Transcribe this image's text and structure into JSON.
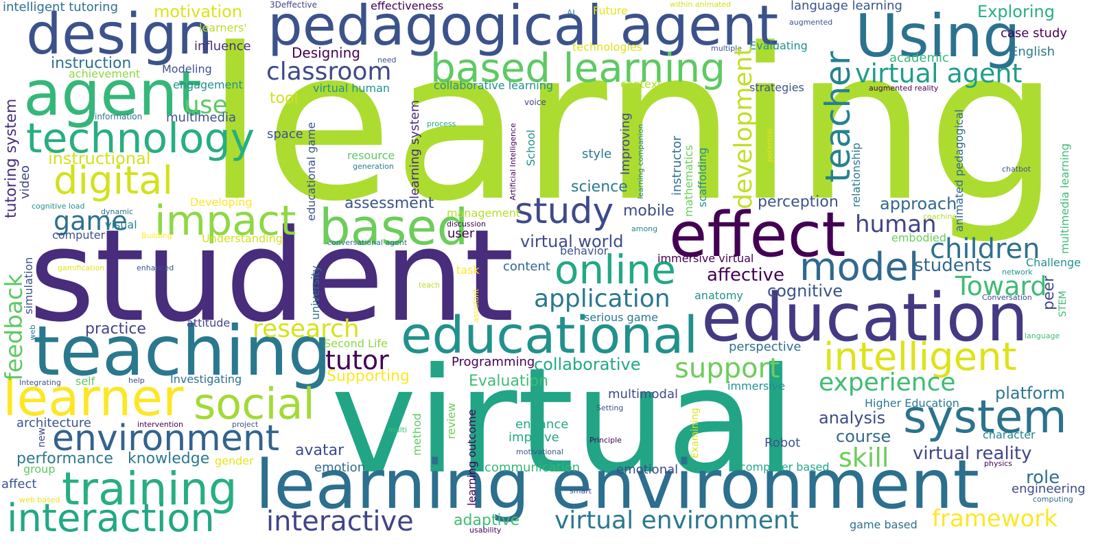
{
  "palette": [
    "#440154",
    "#472d7b",
    "#3b528b",
    "#2c728e",
    "#21918c",
    "#28ae80",
    "#5ec962",
    "#addc30",
    "#fde725"
  ],
  "words": [
    {
      "text": "learning",
      "color": "#addc30"
    },
    {
      "text": "student",
      "color": "#472d7b"
    },
    {
      "text": "virtual",
      "color": "#21a585"
    },
    {
      "text": "learning environment",
      "color": "#2c6f8e"
    },
    {
      "text": "education",
      "color": "#443a83"
    },
    {
      "text": "educational",
      "color": "#21918c"
    },
    {
      "text": "teaching",
      "color": "#2a788e"
    },
    {
      "text": "pedagogical agent",
      "color": "#3b528b"
    },
    {
      "text": "design",
      "color": "#3b528b"
    },
    {
      "text": "agent",
      "color": "#35b779"
    },
    {
      "text": "Using",
      "color": "#2c728e"
    },
    {
      "text": "effect",
      "color": "#440154"
    },
    {
      "text": "technology",
      "color": "#28ae80"
    },
    {
      "text": "based learning",
      "color": "#5ec962"
    },
    {
      "text": "learner",
      "color": "#fde725"
    },
    {
      "text": "training",
      "color": "#28ae80"
    },
    {
      "text": "interaction",
      "color": "#22a884"
    },
    {
      "text": "system",
      "color": "#2c728e"
    },
    {
      "text": "intelligent",
      "color": "#dde318"
    },
    {
      "text": "online",
      "color": "#22a884"
    },
    {
      "text": "based",
      "color": "#6ccd5a"
    },
    {
      "text": "digital",
      "color": "#d2e21b"
    },
    {
      "text": "impact",
      "color": "#8fd744"
    },
    {
      "text": "social",
      "color": "#a2da37"
    },
    {
      "text": "environment",
      "color": "#33638d"
    },
    {
      "text": "model",
      "color": "#31688e"
    },
    {
      "text": "study",
      "color": "#3e4a89"
    },
    {
      "text": "classroom",
      "color": "#3e4a89"
    },
    {
      "text": "virtual agent",
      "color": "#1f9e89"
    },
    {
      "text": "teacher",
      "color": "#26828e"
    },
    {
      "text": "development",
      "color": "#c0df25"
    },
    {
      "text": "application",
      "color": "#2a788e"
    },
    {
      "text": "virtual environment",
      "color": "#2a788e"
    },
    {
      "text": "framework",
      "color": "#fde725"
    },
    {
      "text": "interactive",
      "color": "#414487"
    },
    {
      "text": "research",
      "color": "#d8e219"
    },
    {
      "text": "support",
      "color": "#6ccd5a"
    },
    {
      "text": "experience",
      "color": "#3fbc73"
    },
    {
      "text": "children",
      "color": "#2d708e"
    },
    {
      "text": "game",
      "color": "#2d708e"
    },
    {
      "text": "tutor",
      "color": "#440154"
    },
    {
      "text": "feedback",
      "color": "#5ec962"
    },
    {
      "text": "use",
      "color": "#5ec962"
    },
    {
      "text": "Toward",
      "color": "#3fbc73"
    },
    {
      "text": "virtual world",
      "color": "#3e4a89"
    },
    {
      "text": "human",
      "color": "#414487"
    },
    {
      "text": "students",
      "color": "#31688e"
    },
    {
      "text": "skill",
      "color": "#6ccd5a"
    },
    {
      "text": "collaborative",
      "color": "#22a884"
    },
    {
      "text": "virtual reality",
      "color": "#414487"
    },
    {
      "text": "affective",
      "color": "#440154"
    },
    {
      "text": "cognitive",
      "color": "#3b528b"
    },
    {
      "text": "approach",
      "color": "#31688e"
    },
    {
      "text": "assessment",
      "color": "#3b528b"
    },
    {
      "text": "perception",
      "color": "#3b528b"
    },
    {
      "text": "analysis",
      "color": "#3e4a89"
    },
    {
      "text": "course",
      "color": "#31688e"
    },
    {
      "text": "role",
      "color": "#2d708e"
    },
    {
      "text": "engineering",
      "color": "#3e4a89"
    },
    {
      "text": "platform",
      "color": "#2a788e"
    },
    {
      "text": "Exploring",
      "color": "#28ae80"
    },
    {
      "text": "instructional",
      "color": "#d2e21b"
    },
    {
      "text": "instruction",
      "color": "#2d708e"
    },
    {
      "text": "motivation",
      "color": "#dde318"
    },
    {
      "text": "intelligent tutoring",
      "color": "#2d708e"
    },
    {
      "text": "language learning",
      "color": "#3b528b"
    },
    {
      "text": "case study",
      "color": "#440154"
    },
    {
      "text": "English",
      "color": "#2a788e"
    },
    {
      "text": "academic",
      "color": "#35b779"
    },
    {
      "text": "tutoring system",
      "color": "#472d7b"
    },
    {
      "text": "multimedia",
      "color": "#3b528b"
    },
    {
      "text": "practice",
      "color": "#414487"
    },
    {
      "text": "architecture",
      "color": "#3b528b"
    },
    {
      "text": "performance",
      "color": "#2a788e"
    },
    {
      "text": "knowledge",
      "color": "#2a788e"
    },
    {
      "text": "avatar",
      "color": "#3e4a89"
    },
    {
      "text": "emotion",
      "color": "#31688e"
    },
    {
      "text": "communication",
      "color": "#35b779"
    },
    {
      "text": "emotional",
      "color": "#3e4a89"
    },
    {
      "text": "adaptive",
      "color": "#3fbc73"
    },
    {
      "text": "mobile",
      "color": "#3e4a89"
    },
    {
      "text": "behavior",
      "color": "#3b528b"
    },
    {
      "text": "content",
      "color": "#31688e"
    },
    {
      "text": "immersive virtual",
      "color": "#440154"
    },
    {
      "text": "anatomy",
      "color": "#21918c"
    },
    {
      "text": "serious game",
      "color": "#2a788e"
    },
    {
      "text": "perspective",
      "color": "#2d708e"
    },
    {
      "text": "Evaluation",
      "color": "#3fbc73"
    },
    {
      "text": "multimodal",
      "color": "#3e4a89"
    },
    {
      "text": "immersive",
      "color": "#21918c"
    },
    {
      "text": "Higher Education",
      "color": "#2a788e"
    },
    {
      "text": "character",
      "color": "#26828e"
    },
    {
      "text": "Robot",
      "color": "#3b528b"
    },
    {
      "text": "enhance",
      "color": "#22a884"
    },
    {
      "text": "improve",
      "color": "#22a884"
    },
    {
      "text": "Programming",
      "color": "#440154"
    },
    {
      "text": "Supporting",
      "color": "#fde725"
    },
    {
      "text": "Second Life",
      "color": "#8fd744"
    },
    {
      "text": "science",
      "color": "#2a788e"
    },
    {
      "text": "style",
      "color": "#2a788e"
    },
    {
      "text": "tool",
      "color": "#d2e21b"
    },
    {
      "text": "space",
      "color": "#3b528b"
    },
    {
      "text": "engagement",
      "color": "#21918c"
    },
    {
      "text": "Modeling",
      "color": "#3b528b"
    },
    {
      "text": "achievement",
      "color": "#8fd744"
    },
    {
      "text": "Designing",
      "color": "#440154"
    },
    {
      "text": "influence",
      "color": "#472d7b"
    },
    {
      "text": "learners'",
      "color": "#b5de2b"
    },
    {
      "text": "effectiveness",
      "color": "#440154"
    },
    {
      "text": "technologies",
      "color": "#dde318"
    },
    {
      "text": "Future",
      "color": "#e5e419"
    },
    {
      "text": "context",
      "color": "#b5de2b"
    },
    {
      "text": "collaborative learning",
      "color": "#21918c"
    },
    {
      "text": "virtual human",
      "color": "#21918c"
    },
    {
      "text": "strategies",
      "color": "#3b528b"
    },
    {
      "text": "Evaluating",
      "color": "#21918c"
    },
    {
      "text": "resource",
      "color": "#5ec962"
    },
    {
      "text": "management",
      "color": "#b5de2b"
    },
    {
      "text": "user",
      "color": "#440154"
    },
    {
      "text": "Understanding",
      "color": "#d2e21b"
    },
    {
      "text": "Developing",
      "color": "#fde725"
    },
    {
      "text": "computer",
      "color": "#3b528b"
    },
    {
      "text": "visual",
      "color": "#26828e"
    },
    {
      "text": "attitude",
      "color": "#414487"
    },
    {
      "text": "Investigating",
      "color": "#2d708e"
    },
    {
      "text": "self",
      "color": "#5ec962"
    },
    {
      "text": "gender",
      "color": "#e5e419"
    },
    {
      "text": "group",
      "color": "#5ec962"
    },
    {
      "text": "affect",
      "color": "#3b528b"
    },
    {
      "text": "task",
      "color": "#fde725"
    },
    {
      "text": "embodied",
      "color": "#6ccd5a"
    },
    {
      "text": "Challenge",
      "color": "#21918c"
    },
    {
      "text": "peer",
      "color": "#3e4a89"
    },
    {
      "text": "computer based",
      "color": "#22a884"
    },
    {
      "text": "game based",
      "color": "#2d708e"
    },
    {
      "text": "Improving",
      "color": "#3e4a89"
    },
    {
      "text": "instructor",
      "color": "#2d708e"
    },
    {
      "text": "mathematics",
      "color": "#6ccd5a"
    },
    {
      "text": "scaffolding",
      "color": "#21918c"
    },
    {
      "text": "learning system",
      "color": "#472d7b"
    },
    {
      "text": "educational game",
      "color": "#3b528b"
    },
    {
      "text": "School",
      "color": "#21918c"
    },
    {
      "text": "Artificial Intelligence",
      "color": "#440154"
    },
    {
      "text": "learning companion",
      "color": "#26828e"
    },
    {
      "text": "relationship",
      "color": "#2a788e"
    },
    {
      "text": "animated pedagogical",
      "color": "#31688e"
    },
    {
      "text": "multimedia learning",
      "color": "#3fbc73"
    },
    {
      "text": "STEM",
      "color": "#3fbc73"
    },
    {
      "text": "university",
      "color": "#2d708e"
    },
    {
      "text": "simulation",
      "color": "#3b528b"
    },
    {
      "text": "video",
      "color": "#414487"
    },
    {
      "text": "method",
      "color": "#5ec962"
    },
    {
      "text": "review",
      "color": "#6ccd5a"
    },
    {
      "text": "learning outcome",
      "color": "#440154"
    },
    {
      "text": "Examining",
      "color": "#dde318"
    },
    {
      "text": "new",
      "color": "#414487"
    },
    {
      "text": "web",
      "color": "#2a788e"
    },
    {
      "text": "assistant",
      "color": "#fde725"
    },
    {
      "text": "potential",
      "color": "#e5e419"
    },
    {
      "text": "3Deffective",
      "color": "#414487"
    },
    {
      "text": "AI",
      "color": "#2a788e"
    },
    {
      "text": "within animated",
      "color": "#d2e21b"
    },
    {
      "text": "augmented",
      "color": "#3b528b"
    },
    {
      "text": "multiple",
      "color": "#3b528b"
    },
    {
      "text": "need",
      "color": "#3b528b"
    },
    {
      "text": "augmented reality",
      "color": "#440154"
    },
    {
      "text": "information",
      "color": "#2d708e"
    },
    {
      "text": "voice",
      "color": "#414487"
    },
    {
      "text": "process",
      "color": "#22a884"
    },
    {
      "text": "generation",
      "color": "#2a788e"
    },
    {
      "text": "chatbot",
      "color": "#3b528b"
    },
    {
      "text": "cognitive load",
      "color": "#21918c"
    },
    {
      "text": "dynamic",
      "color": "#2d708e"
    },
    {
      "text": "Building",
      "color": "#fde725"
    },
    {
      "text": "discussion",
      "color": "#440154"
    },
    {
      "text": "among",
      "color": "#26828e"
    },
    {
      "text": "coaching",
      "color": "#b5de2b"
    },
    {
      "text": "conversational agent",
      "color": "#2d708e"
    },
    {
      "text": "gamification",
      "color": "#e5e419"
    },
    {
      "text": "enhanced",
      "color": "#3b528b"
    },
    {
      "text": "teach",
      "color": "#b5de2b"
    },
    {
      "text": "network",
      "color": "#21918c"
    },
    {
      "text": "Conversation",
      "color": "#3e4a89"
    },
    {
      "text": "language",
      "color": "#3fbc73"
    },
    {
      "text": "Integrating",
      "color": "#3b528b"
    },
    {
      "text": "help",
      "color": "#3e4a89"
    },
    {
      "text": "Setting",
      "color": "#3b528b"
    },
    {
      "text": "intervention",
      "color": "#440154"
    },
    {
      "text": "project",
      "color": "#3b528b"
    },
    {
      "text": "multi",
      "color": "#3fbc73"
    },
    {
      "text": "Principle",
      "color": "#440154"
    },
    {
      "text": "motivational",
      "color": "#3b528b"
    },
    {
      "text": "physics",
      "color": "#440154"
    },
    {
      "text": "computing",
      "color": "#31688e"
    },
    {
      "text": "smart",
      "color": "#3b528b"
    },
    {
      "text": "web based",
      "color": "#e5e419"
    },
    {
      "text": "usability",
      "color": "#440154"
    }
  ]
}
